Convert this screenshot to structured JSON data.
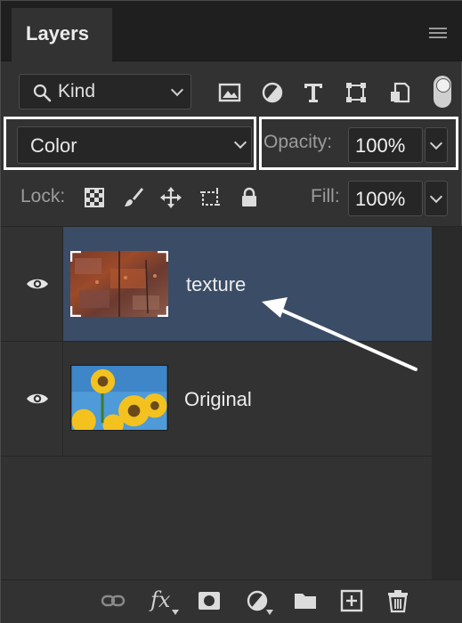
{
  "panel": {
    "tab_label": "Layers",
    "menu_icon": "panel-menu-icon"
  },
  "filter": {
    "kind_label": "Kind",
    "icons": [
      "image-filter-icon",
      "adjustment-filter-icon",
      "type-filter-icon",
      "shape-filter-icon",
      "smart-object-filter-icon"
    ],
    "toggle_on": true
  },
  "blend": {
    "mode": "Color",
    "opacity_label": "Opacity:",
    "opacity_value": "100%"
  },
  "lock": {
    "label": "Lock:",
    "icons": [
      "lock-transparent-pixels-icon",
      "lock-image-pixels-icon",
      "lock-position-icon",
      "lock-artboard-icon",
      "lock-all-icon"
    ],
    "fill_label": "Fill:",
    "fill_value": "100%"
  },
  "layers": [
    {
      "name": "texture",
      "visible": true,
      "selected": true,
      "thumbnail": "rusty-metal-texture"
    },
    {
      "name": "Original",
      "visible": true,
      "selected": false,
      "thumbnail": "sunflowers-blue-sky"
    }
  ],
  "footer": {
    "fx_label": "fx",
    "icons": [
      "link-layers-icon",
      "layer-style-icon",
      "layer-mask-icon",
      "adjustment-layer-icon",
      "group-folder-icon",
      "new-layer-icon",
      "trash-icon"
    ]
  },
  "colors": {
    "panel_bg": "#323232",
    "selected_row": "#3b4c66",
    "highlight": "#ffffff"
  }
}
